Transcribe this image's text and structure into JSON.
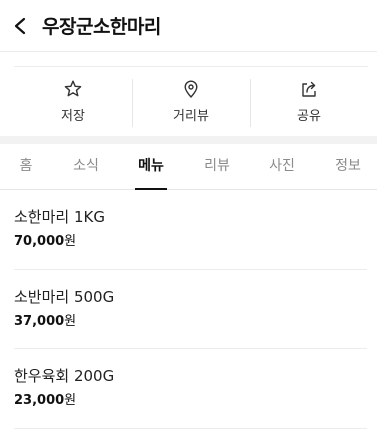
{
  "header": {
    "title": "우장군소한마리",
    "back_icon": "chevron-left-icon"
  },
  "actions": [
    {
      "label": "저장",
      "icon": "star-icon"
    },
    {
      "label": "거리뷰",
      "icon": "location-pin-icon"
    },
    {
      "label": "공유",
      "icon": "share-icon"
    }
  ],
  "tabs": [
    {
      "label": "홈"
    },
    {
      "label": "소식"
    },
    {
      "label": "메뉴"
    },
    {
      "label": "리뷰"
    },
    {
      "label": "사진"
    },
    {
      "label": "정보"
    }
  ],
  "active_tab": "메뉴",
  "menu": [
    {
      "name": "소한마리 1KG",
      "price": "70,000",
      "unit": "원"
    },
    {
      "name": "소반마리 500G",
      "price": "37,000",
      "unit": "원"
    },
    {
      "name": "한우육회 200G",
      "price": "23,000",
      "unit": "원"
    }
  ]
}
